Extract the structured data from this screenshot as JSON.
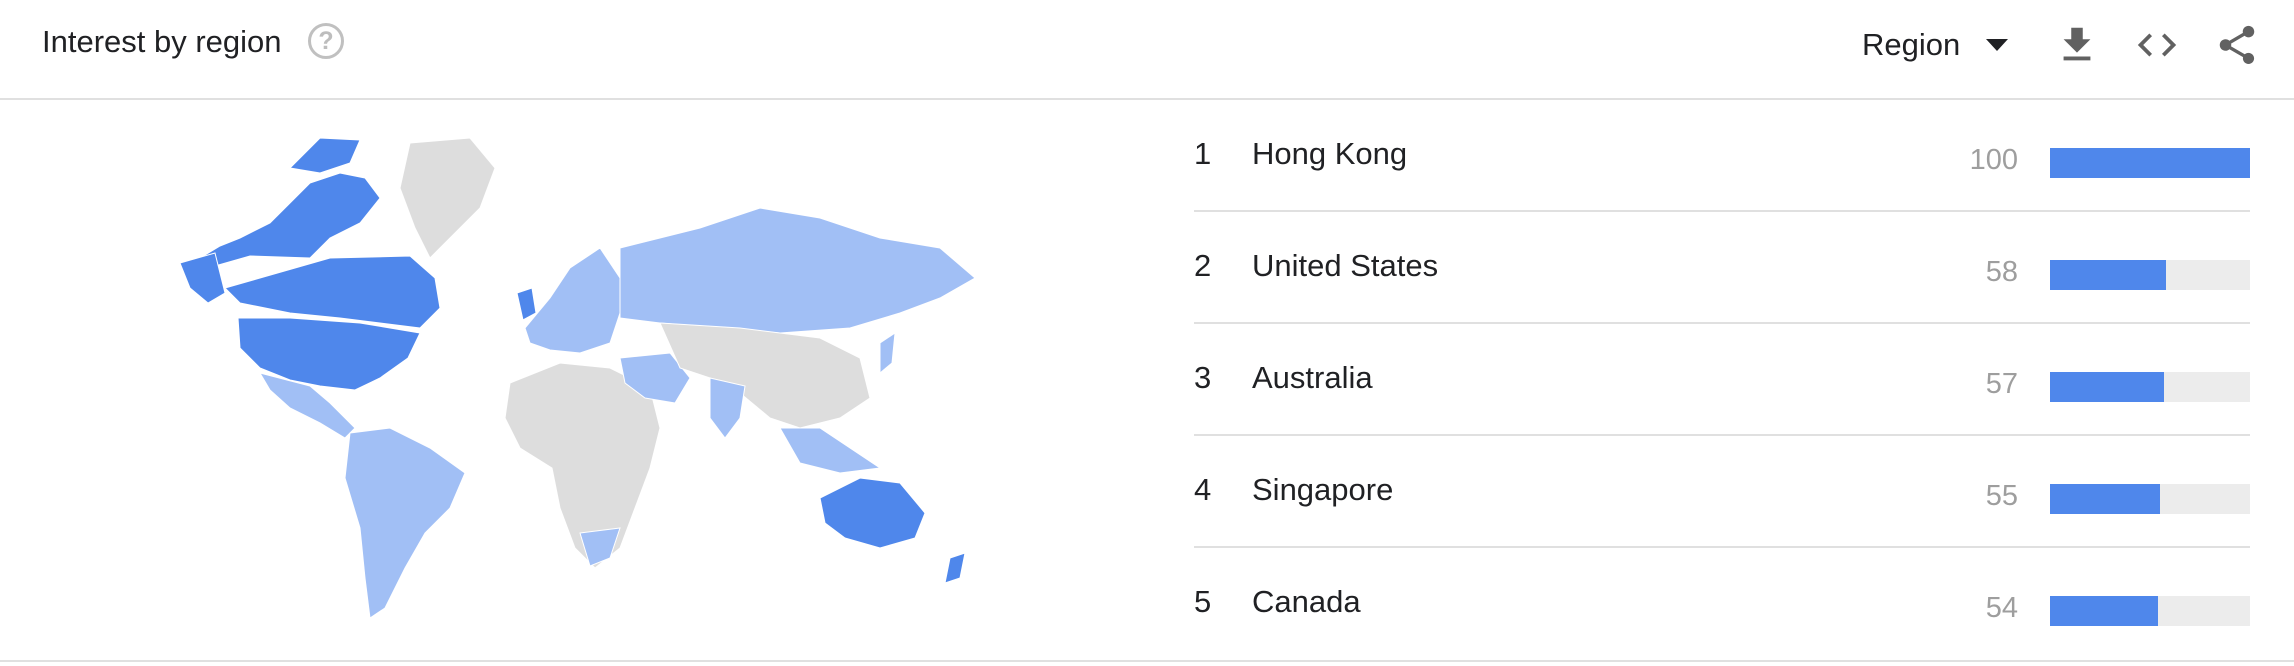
{
  "header": {
    "title": "Interest by region",
    "help_symbol": "?",
    "resolution_label": "Region",
    "icons": [
      "help-icon",
      "download-icon",
      "embed-icon",
      "share-icon"
    ]
  },
  "colors": {
    "bar_fill": "#4f87eb",
    "bar_track": "#ececec",
    "map_high": "#4f87eb",
    "map_low": "#a1bff5",
    "map_none": "#dddddd"
  },
  "chart_data": {
    "type": "bar",
    "categories": [
      "Hong Kong",
      "United States",
      "Australia",
      "Singapore",
      "Canada"
    ],
    "values": [
      100,
      58,
      57,
      55,
      54
    ],
    "ylim": [
      0,
      100
    ]
  },
  "regions": [
    {
      "rank": "1",
      "name": "Hong Kong",
      "value": 100
    },
    {
      "rank": "2",
      "name": "United States",
      "value": 58
    },
    {
      "rank": "3",
      "name": "Australia",
      "value": 57
    },
    {
      "rank": "4",
      "name": "Singapore",
      "value": 55
    },
    {
      "rank": "5",
      "name": "Canada",
      "value": 54
    }
  ]
}
